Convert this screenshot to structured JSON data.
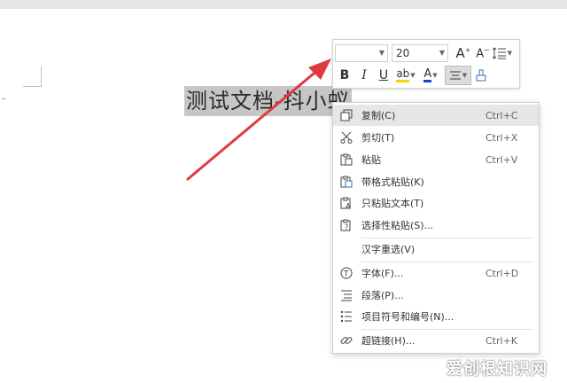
{
  "document": {
    "selected_text": "测试文档-抖小蚁"
  },
  "mini_toolbar": {
    "font_name": "",
    "font_size": "20",
    "grow_font_icon": "A+",
    "shrink_font_icon": "A-",
    "bold": "B",
    "italic": "I",
    "underline": "U",
    "highlight": "ab",
    "font_color": "A",
    "highlight_color": "#f4d300",
    "font_color_bar": "#1f3fbf"
  },
  "context_menu": {
    "items": [
      {
        "label": "复制(C)",
        "shortcut": "Ctrl+C",
        "icon": "copy-icon"
      },
      {
        "label": "剪切(T)",
        "shortcut": "Ctrl+X",
        "icon": "scissors-icon"
      },
      {
        "label": "粘贴",
        "shortcut": "Ctrl+V",
        "icon": "paste-icon"
      },
      {
        "label": "带格式粘贴(K)",
        "shortcut": "",
        "icon": "paste-format-icon"
      },
      {
        "label": "只粘贴文本(T)",
        "shortcut": "",
        "icon": "paste-text-icon"
      },
      {
        "label": "选择性粘贴(S)...",
        "shortcut": "",
        "icon": "paste-special-icon"
      },
      {
        "label": "汉字重选(V)",
        "shortcut": "",
        "icon": ""
      },
      {
        "label": "字体(F)...",
        "shortcut": "Ctrl+D",
        "icon": "font-icon"
      },
      {
        "label": "段落(P)...",
        "shortcut": "",
        "icon": "paragraph-icon"
      },
      {
        "label": "项目符号和编号(N)...",
        "shortcut": "",
        "icon": "list-icon"
      },
      {
        "label": "超链接(H)...",
        "shortcut": "Ctrl+K",
        "icon": "link-icon"
      }
    ]
  },
  "watermark": "爱创根知识网",
  "colors": {
    "arrow": "#e0393f",
    "selection": "#c6c6c6"
  }
}
